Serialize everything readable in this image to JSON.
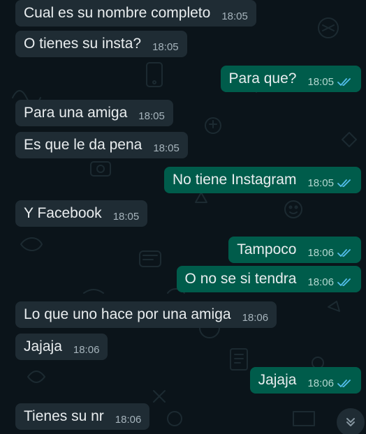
{
  "chat": {
    "messages": [
      {
        "direction": "in",
        "text": "Cual es su nombre completo",
        "time": "18:05"
      },
      {
        "direction": "in",
        "text": "O tienes su insta?",
        "time": "18:05"
      },
      {
        "direction": "out",
        "text": "Para que?",
        "time": "18:05",
        "status": "read"
      },
      {
        "direction": "in",
        "text": "Para una amiga",
        "time": "18:05"
      },
      {
        "direction": "in",
        "text": "Es que le da pena",
        "time": "18:05"
      },
      {
        "direction": "out",
        "text": "No tiene Instagram",
        "time": "18:05",
        "status": "read"
      },
      {
        "direction": "in",
        "text": "Y Facebook",
        "time": "18:05"
      },
      {
        "direction": "out",
        "text": "Tampoco",
        "time": "18:06",
        "status": "read"
      },
      {
        "direction": "out",
        "text": "O no se si tendra",
        "time": "18:06",
        "status": "read"
      },
      {
        "direction": "in",
        "text": "Lo que uno hace por una amiga",
        "time": "18:06"
      },
      {
        "direction": "in",
        "text": "Jajaja",
        "time": "18:06"
      },
      {
        "direction": "out",
        "text": "Jajaja",
        "time": "18:06",
        "status": "read"
      },
      {
        "direction": "in",
        "text": "Tienes su nr",
        "time": "18:06"
      }
    ],
    "scroll_button": {
      "icon": "double-chevron-down-icon"
    }
  },
  "colors": {
    "background": "#0b141a",
    "incoming_bubble": "#1f2c34",
    "outgoing_bubble": "#005c4b",
    "read_ticks": "#53bdeb"
  }
}
